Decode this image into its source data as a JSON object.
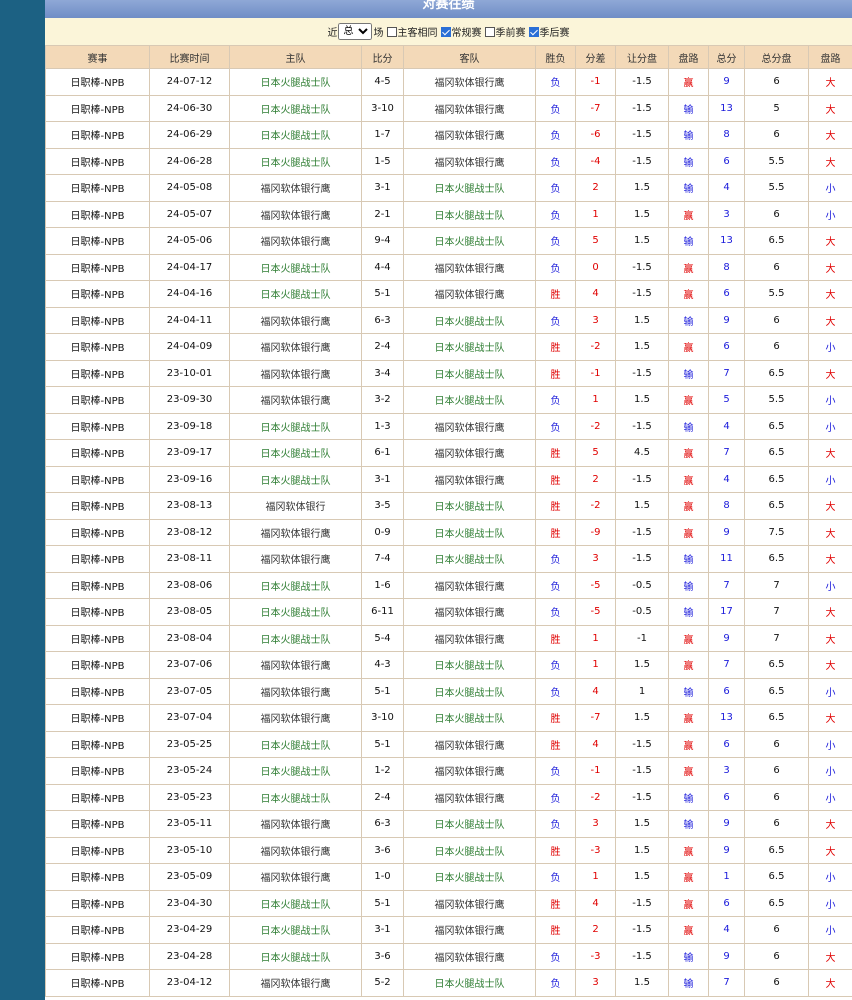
{
  "panel": {
    "title": "对赛往绩",
    "filter": {
      "prefix": "近",
      "select_value": "总",
      "suffix": "场",
      "options": [
        {
          "label": "主客相同",
          "checked": false
        },
        {
          "label": "常规赛",
          "checked": true
        },
        {
          "label": "季前赛",
          "checked": false
        },
        {
          "label": "季后赛",
          "checked": true
        }
      ]
    }
  },
  "table": {
    "headers": [
      "赛事",
      "比赛时间",
      "主队",
      "比分",
      "客队",
      "胜负",
      "分差",
      "让分盘",
      "盘路",
      "总分",
      "总分盘",
      "盘路"
    ],
    "focus_team": "日本火腿战士队",
    "rows": [
      [
        "日职棒-NPB",
        "24-07-12",
        "日本火腿战士队",
        "4-5",
        "福冈软体银行鹰",
        "负",
        "-1",
        "-1.5",
        "赢",
        "9",
        "6",
        "大"
      ],
      [
        "日职棒-NPB",
        "24-06-30",
        "日本火腿战士队",
        "3-10",
        "福冈软体银行鹰",
        "负",
        "-7",
        "-1.5",
        "输",
        "13",
        "5",
        "大"
      ],
      [
        "日职棒-NPB",
        "24-06-29",
        "日本火腿战士队",
        "1-7",
        "福冈软体银行鹰",
        "负",
        "-6",
        "-1.5",
        "输",
        "8",
        "6",
        "大"
      ],
      [
        "日职棒-NPB",
        "24-06-28",
        "日本火腿战士队",
        "1-5",
        "福冈软体银行鹰",
        "负",
        "-4",
        "-1.5",
        "输",
        "6",
        "5.5",
        "大"
      ],
      [
        "日职棒-NPB",
        "24-05-08",
        "福冈软体银行鹰",
        "3-1",
        "日本火腿战士队",
        "负",
        "2",
        "1.5",
        "输",
        "4",
        "5.5",
        "小"
      ],
      [
        "日职棒-NPB",
        "24-05-07",
        "福冈软体银行鹰",
        "2-1",
        "日本火腿战士队",
        "负",
        "1",
        "1.5",
        "赢",
        "3",
        "6",
        "小"
      ],
      [
        "日职棒-NPB",
        "24-05-06",
        "福冈软体银行鹰",
        "9-4",
        "日本火腿战士队",
        "负",
        "5",
        "1.5",
        "输",
        "13",
        "6.5",
        "大"
      ],
      [
        "日职棒-NPB",
        "24-04-17",
        "日本火腿战士队",
        "4-4",
        "福冈软体银行鹰",
        "负",
        "0",
        "-1.5",
        "赢",
        "8",
        "6",
        "大"
      ],
      [
        "日职棒-NPB",
        "24-04-16",
        "日本火腿战士队",
        "5-1",
        "福冈软体银行鹰",
        "胜",
        "4",
        "-1.5",
        "赢",
        "6",
        "5.5",
        "大"
      ],
      [
        "日职棒-NPB",
        "24-04-11",
        "福冈软体银行鹰",
        "6-3",
        "日本火腿战士队",
        "负",
        "3",
        "1.5",
        "输",
        "9",
        "6",
        "大"
      ],
      [
        "日职棒-NPB",
        "24-04-09",
        "福冈软体银行鹰",
        "2-4",
        "日本火腿战士队",
        "胜",
        "-2",
        "1.5",
        "赢",
        "6",
        "6",
        "小"
      ],
      [
        "日职棒-NPB",
        "23-10-01",
        "福冈软体银行鹰",
        "3-4",
        "日本火腿战士队",
        "胜",
        "-1",
        "-1.5",
        "输",
        "7",
        "6.5",
        "大"
      ],
      [
        "日职棒-NPB",
        "23-09-30",
        "福冈软体银行鹰",
        "3-2",
        "日本火腿战士队",
        "负",
        "1",
        "1.5",
        "赢",
        "5",
        "5.5",
        "小"
      ],
      [
        "日职棒-NPB",
        "23-09-18",
        "日本火腿战士队",
        "1-3",
        "福冈软体银行鹰",
        "负",
        "-2",
        "-1.5",
        "输",
        "4",
        "6.5",
        "小"
      ],
      [
        "日职棒-NPB",
        "23-09-17",
        "日本火腿战士队",
        "6-1",
        "福冈软体银行鹰",
        "胜",
        "5",
        "4.5",
        "赢",
        "7",
        "6.5",
        "大"
      ],
      [
        "日职棒-NPB",
        "23-09-16",
        "日本火腿战士队",
        "3-1",
        "福冈软体银行鹰",
        "胜",
        "2",
        "-1.5",
        "赢",
        "4",
        "6.5",
        "小"
      ],
      [
        "日职棒-NPB",
        "23-08-13",
        "福冈软体银行",
        "3-5",
        "日本火腿战士队",
        "胜",
        "-2",
        "1.5",
        "赢",
        "8",
        "6.5",
        "大"
      ],
      [
        "日职棒-NPB",
        "23-08-12",
        "福冈软体银行鹰",
        "0-9",
        "日本火腿战士队",
        "胜",
        "-9",
        "-1.5",
        "赢",
        "9",
        "7.5",
        "大"
      ],
      [
        "日职棒-NPB",
        "23-08-11",
        "福冈软体银行鹰",
        "7-4",
        "日本火腿战士队",
        "负",
        "3",
        "-1.5",
        "输",
        "11",
        "6.5",
        "大"
      ],
      [
        "日职棒-NPB",
        "23-08-06",
        "日本火腿战士队",
        "1-6",
        "福冈软体银行鹰",
        "负",
        "-5",
        "-0.5",
        "输",
        "7",
        "7",
        "小"
      ],
      [
        "日职棒-NPB",
        "23-08-05",
        "日本火腿战士队",
        "6-11",
        "福冈软体银行鹰",
        "负",
        "-5",
        "-0.5",
        "输",
        "17",
        "7",
        "大"
      ],
      [
        "日职棒-NPB",
        "23-08-04",
        "日本火腿战士队",
        "5-4",
        "福冈软体银行鹰",
        "胜",
        "1",
        "-1",
        "赢",
        "9",
        "7",
        "大"
      ],
      [
        "日职棒-NPB",
        "23-07-06",
        "福冈软体银行鹰",
        "4-3",
        "日本火腿战士队",
        "负",
        "1",
        "1.5",
        "赢",
        "7",
        "6.5",
        "大"
      ],
      [
        "日职棒-NPB",
        "23-07-05",
        "福冈软体银行鹰",
        "5-1",
        "日本火腿战士队",
        "负",
        "4",
        "1",
        "输",
        "6",
        "6.5",
        "小"
      ],
      [
        "日职棒-NPB",
        "23-07-04",
        "福冈软体银行鹰",
        "3-10",
        "日本火腿战士队",
        "胜",
        "-7",
        "1.5",
        "赢",
        "13",
        "6.5",
        "大"
      ],
      [
        "日职棒-NPB",
        "23-05-25",
        "日本火腿战士队",
        "5-1",
        "福冈软体银行鹰",
        "胜",
        "4",
        "-1.5",
        "赢",
        "6",
        "6",
        "小"
      ],
      [
        "日职棒-NPB",
        "23-05-24",
        "日本火腿战士队",
        "1-2",
        "福冈软体银行鹰",
        "负",
        "-1",
        "-1.5",
        "赢",
        "3",
        "6",
        "小"
      ],
      [
        "日职棒-NPB",
        "23-05-23",
        "日本火腿战士队",
        "2-4",
        "福冈软体银行鹰",
        "负",
        "-2",
        "-1.5",
        "输",
        "6",
        "6",
        "小"
      ],
      [
        "日职棒-NPB",
        "23-05-11",
        "福冈软体银行鹰",
        "6-3",
        "日本火腿战士队",
        "负",
        "3",
        "1.5",
        "输",
        "9",
        "6",
        "大"
      ],
      [
        "日职棒-NPB",
        "23-05-10",
        "福冈软体银行鹰",
        "3-6",
        "日本火腿战士队",
        "胜",
        "-3",
        "1.5",
        "赢",
        "9",
        "6.5",
        "大"
      ],
      [
        "日职棒-NPB",
        "23-05-09",
        "福冈软体银行鹰",
        "1-0",
        "日本火腿战士队",
        "负",
        "1",
        "1.5",
        "赢",
        "1",
        "6.5",
        "小"
      ],
      [
        "日职棒-NPB",
        "23-04-30",
        "日本火腿战士队",
        "5-1",
        "福冈软体银行鹰",
        "胜",
        "4",
        "-1.5",
        "赢",
        "6",
        "6.5",
        "小"
      ],
      [
        "日职棒-NPB",
        "23-04-29",
        "日本火腿战士队",
        "3-1",
        "福冈软体银行鹰",
        "胜",
        "2",
        "-1.5",
        "赢",
        "4",
        "6",
        "小"
      ],
      [
        "日职棒-NPB",
        "23-04-28",
        "日本火腿战士队",
        "3-6",
        "福冈软体银行鹰",
        "负",
        "-3",
        "-1.5",
        "输",
        "9",
        "6",
        "大"
      ],
      [
        "日职棒-NPB",
        "23-04-12",
        "福冈软体银行鹰",
        "5-2",
        "日本火腿战士队",
        "负",
        "3",
        "1.5",
        "输",
        "7",
        "6",
        "大"
      ]
    ]
  },
  "colors": {
    "background": "#1c6183",
    "title_bar": "#7b97cd",
    "filter_bar": "#fbf5d9",
    "header": "#f3d9b8",
    "focus_team": "#2e7d32",
    "red": "#e00000",
    "blue": "#1a1adb"
  }
}
